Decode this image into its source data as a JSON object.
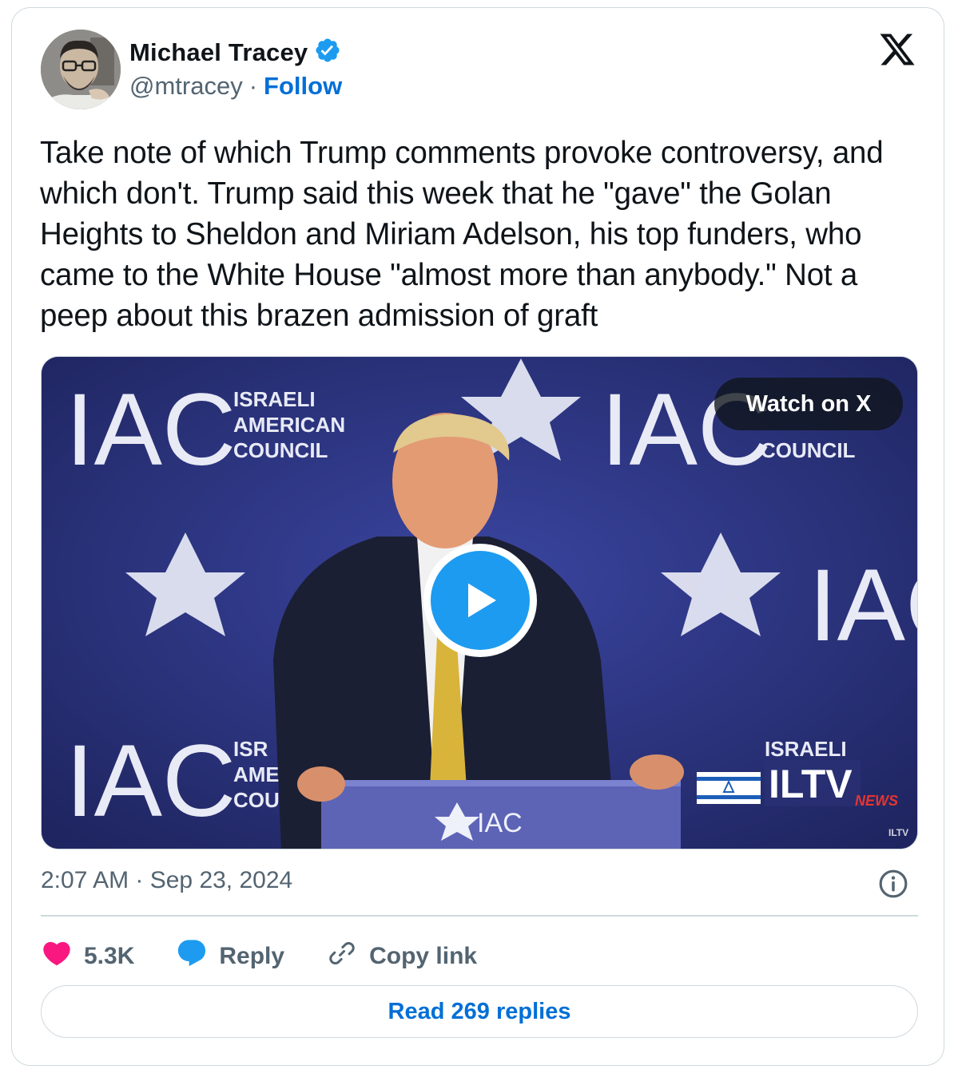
{
  "author": {
    "name": "Michael Tracey",
    "handle": "@mtracey",
    "separator": "·",
    "follow_label": "Follow",
    "verified": true
  },
  "icons": {
    "verified": "verified-badge-icon",
    "brand": "x-logo-icon",
    "like": "heart-icon",
    "reply": "speech-bubble-icon",
    "copy": "link-icon",
    "info": "info-icon",
    "play": "play-icon"
  },
  "tweet": {
    "text": "Take note of which Trump comments provoke controversy, and which don't. Trump said this week that he \"gave\" the Golan Heights to Sheldon and Miriam Adelson, his top funders, who came to the White House \"almost more than anybody.\" Not a peep about this brazen admission of graft"
  },
  "media": {
    "watch_label": "Watch on X",
    "backdrop_logo": "IAC",
    "backdrop_tagline_1": "ISRAELI",
    "backdrop_tagline_2": "AMERICAN",
    "backdrop_tagline_3": "COUNCIL",
    "podium_logo": "IAC",
    "channel_logo": "ILTV",
    "channel_sub": "NEWS"
  },
  "meta": {
    "timestamp": "2:07 AM · Sep 23, 2024"
  },
  "actions": {
    "like_count": "5.3K",
    "reply_label": "Reply",
    "copy_label": "Copy link"
  },
  "footer": {
    "read_replies_label": "Read 269 replies"
  },
  "colors": {
    "accent": "#1d9bf0",
    "link": "#006fd6",
    "like": "#f91880",
    "secondary_text": "#536471",
    "border": "#cfd9de",
    "video_backdrop": "#2b3276"
  }
}
